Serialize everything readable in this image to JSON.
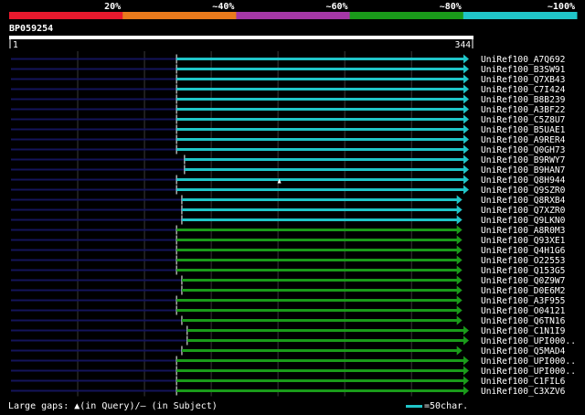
{
  "query_id": "BP059254",
  "identity_scale": {
    "labels": [
      "20%",
      "~40%",
      "~60%",
      "~80%",
      "~100%"
    ],
    "colors": [
      "#e8192d",
      "#ea7a1c",
      "#a537a6",
      "#1a9b1a",
      "#20c5c8"
    ]
  },
  "legend": {
    "left_text": "Large gaps: ▲(in Query)/– (in Subject)",
    "right_text": "=50char.",
    "arrow_color": "#20c5c8"
  },
  "chart_data": {
    "type": "alignment",
    "query_length": 344,
    "ruler_start_label": "1",
    "ruler_end_label": "344",
    "hits": [
      {
        "name": "UniRef100_A7Q692",
        "start": 125,
        "end": 344,
        "color": "#20c5c8",
        "qmarks": []
      },
      {
        "name": "UniRef100_B3SW91",
        "start": 125,
        "end": 344,
        "color": "#20c5c8",
        "qmarks": []
      },
      {
        "name": "UniRef100_Q7XB43",
        "start": 125,
        "end": 344,
        "color": "#20c5c8",
        "qmarks": []
      },
      {
        "name": "UniRef100_C7I424",
        "start": 125,
        "end": 344,
        "color": "#20c5c8",
        "qmarks": []
      },
      {
        "name": "UniRef100_B8B239",
        "start": 125,
        "end": 344,
        "color": "#20c5c8",
        "qmarks": []
      },
      {
        "name": "UniRef100_A3BF22",
        "start": 125,
        "end": 344,
        "color": "#20c5c8",
        "qmarks": []
      },
      {
        "name": "UniRef100_C5Z8U7",
        "start": 125,
        "end": 344,
        "color": "#20c5c8",
        "qmarks": []
      },
      {
        "name": "UniRef100_B5UAE1",
        "start": 125,
        "end": 344,
        "color": "#20c5c8",
        "qmarks": []
      },
      {
        "name": "UniRef100_A9RER4",
        "start": 125,
        "end": 344,
        "color": "#20c5c8",
        "qmarks": []
      },
      {
        "name": "UniRef100_Q0GH73",
        "start": 125,
        "end": 344,
        "color": "#20c5c8",
        "qmarks": []
      },
      {
        "name": "UniRef100_B9RWY7",
        "start": 131,
        "end": 344,
        "color": "#20c5c8",
        "qmarks": []
      },
      {
        "name": "UniRef100_B9HAN7",
        "start": 131,
        "end": 344,
        "color": "#20c5c8",
        "qmarks": []
      },
      {
        "name": "UniRef100_Q8H944",
        "start": 125,
        "end": 344,
        "color": "#20c5c8",
        "qmarks": [
          202
        ]
      },
      {
        "name": "UniRef100_Q9SZR0",
        "start": 125,
        "end": 344,
        "color": "#20c5c8",
        "qmarks": []
      },
      {
        "name": "UniRef100_Q8RXB4",
        "start": 129,
        "end": 339,
        "color": "#20c5c8",
        "qmarks": []
      },
      {
        "name": "UniRef100_Q7XZR0",
        "start": 129,
        "end": 339,
        "color": "#20c5c8",
        "qmarks": []
      },
      {
        "name": "UniRef100_Q9LKN0",
        "start": 129,
        "end": 339,
        "color": "#20c5c8",
        "qmarks": []
      },
      {
        "name": "UniRef100_A8R0M3",
        "start": 125,
        "end": 339,
        "color": "#1a9b1a",
        "qmarks": []
      },
      {
        "name": "UniRef100_Q93XE1",
        "start": 125,
        "end": 339,
        "color": "#1a9b1a",
        "qmarks": []
      },
      {
        "name": "UniRef100_Q4H1G6",
        "start": 125,
        "end": 339,
        "color": "#1a9b1a",
        "qmarks": []
      },
      {
        "name": "UniRef100_O22553",
        "start": 125,
        "end": 339,
        "color": "#1a9b1a",
        "qmarks": []
      },
      {
        "name": "UniRef100_Q153G5",
        "start": 125,
        "end": 339,
        "color": "#1a9b1a",
        "qmarks": []
      },
      {
        "name": "UniRef100_Q0Z9W7",
        "start": 129,
        "end": 339,
        "color": "#1a9b1a",
        "qmarks": []
      },
      {
        "name": "UniRef100_D0E6M2",
        "start": 129,
        "end": 339,
        "color": "#1a9b1a",
        "qmarks": []
      },
      {
        "name": "UniRef100_A3F955",
        "start": 125,
        "end": 339,
        "color": "#1a9b1a",
        "qmarks": []
      },
      {
        "name": "UniRef100_O04121",
        "start": 125,
        "end": 339,
        "color": "#1a9b1a",
        "qmarks": []
      },
      {
        "name": "UniRef100_Q6TN16",
        "start": 129,
        "end": 339,
        "color": "#1a9b1a",
        "qmarks": []
      },
      {
        "name": "UniRef100_C1N1I9",
        "start": 133,
        "end": 344,
        "color": "#1a9b1a",
        "qmarks": []
      },
      {
        "name": "UniRef100_UPI000..",
        "start": 133,
        "end": 344,
        "color": "#1a9b1a",
        "qmarks": []
      },
      {
        "name": "UniRef100_Q5MAD4",
        "start": 129,
        "end": 339,
        "color": "#1a9b1a",
        "qmarks": []
      },
      {
        "name": "UniRef100_UPI000..",
        "start": 125,
        "end": 344,
        "color": "#1a9b1a",
        "qmarks": []
      },
      {
        "name": "UniRef100_UPI000..",
        "start": 125,
        "end": 344,
        "color": "#1a9b1a",
        "qmarks": []
      },
      {
        "name": "UniRef100_C1FIL6",
        "start": 125,
        "end": 344,
        "color": "#1a9b1a",
        "qmarks": []
      },
      {
        "name": "UniRef100_C3XZV6",
        "start": 125,
        "end": 344,
        "color": "#1a9b1a",
        "qmarks": []
      }
    ]
  }
}
